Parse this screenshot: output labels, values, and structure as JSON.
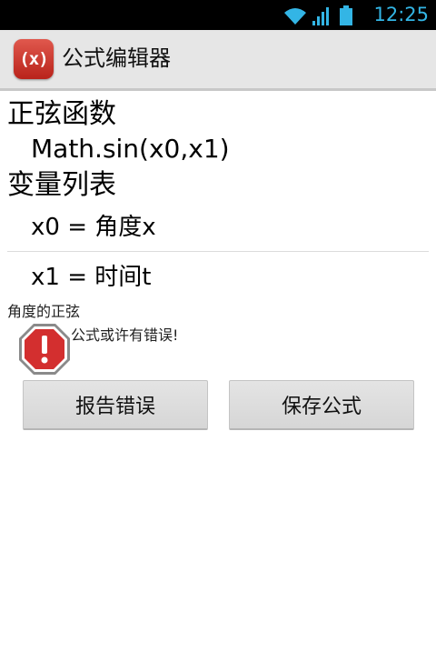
{
  "status_bar": {
    "time": "12:25",
    "icons": [
      "wifi-icon",
      "signal-icon",
      "battery-icon"
    ],
    "time_color": "#33b5e5"
  },
  "action_bar": {
    "app_icon_text": "(x)",
    "title": "公式编辑器",
    "icon_color": "#c9322a"
  },
  "function": {
    "heading": "正弦函数",
    "formula": "Math.sin(x0,x1)"
  },
  "variables": {
    "heading": "变量列表",
    "items": [
      {
        "label": "x0 = 角度x"
      },
      {
        "label": "x1 = 时间t"
      }
    ]
  },
  "description": "角度的正弦",
  "warning": {
    "icon": "error-stop-icon",
    "message": "公式或许有错误!",
    "color": "#d32f2f"
  },
  "buttons": {
    "report": "报告错误",
    "save": "保存公式"
  }
}
